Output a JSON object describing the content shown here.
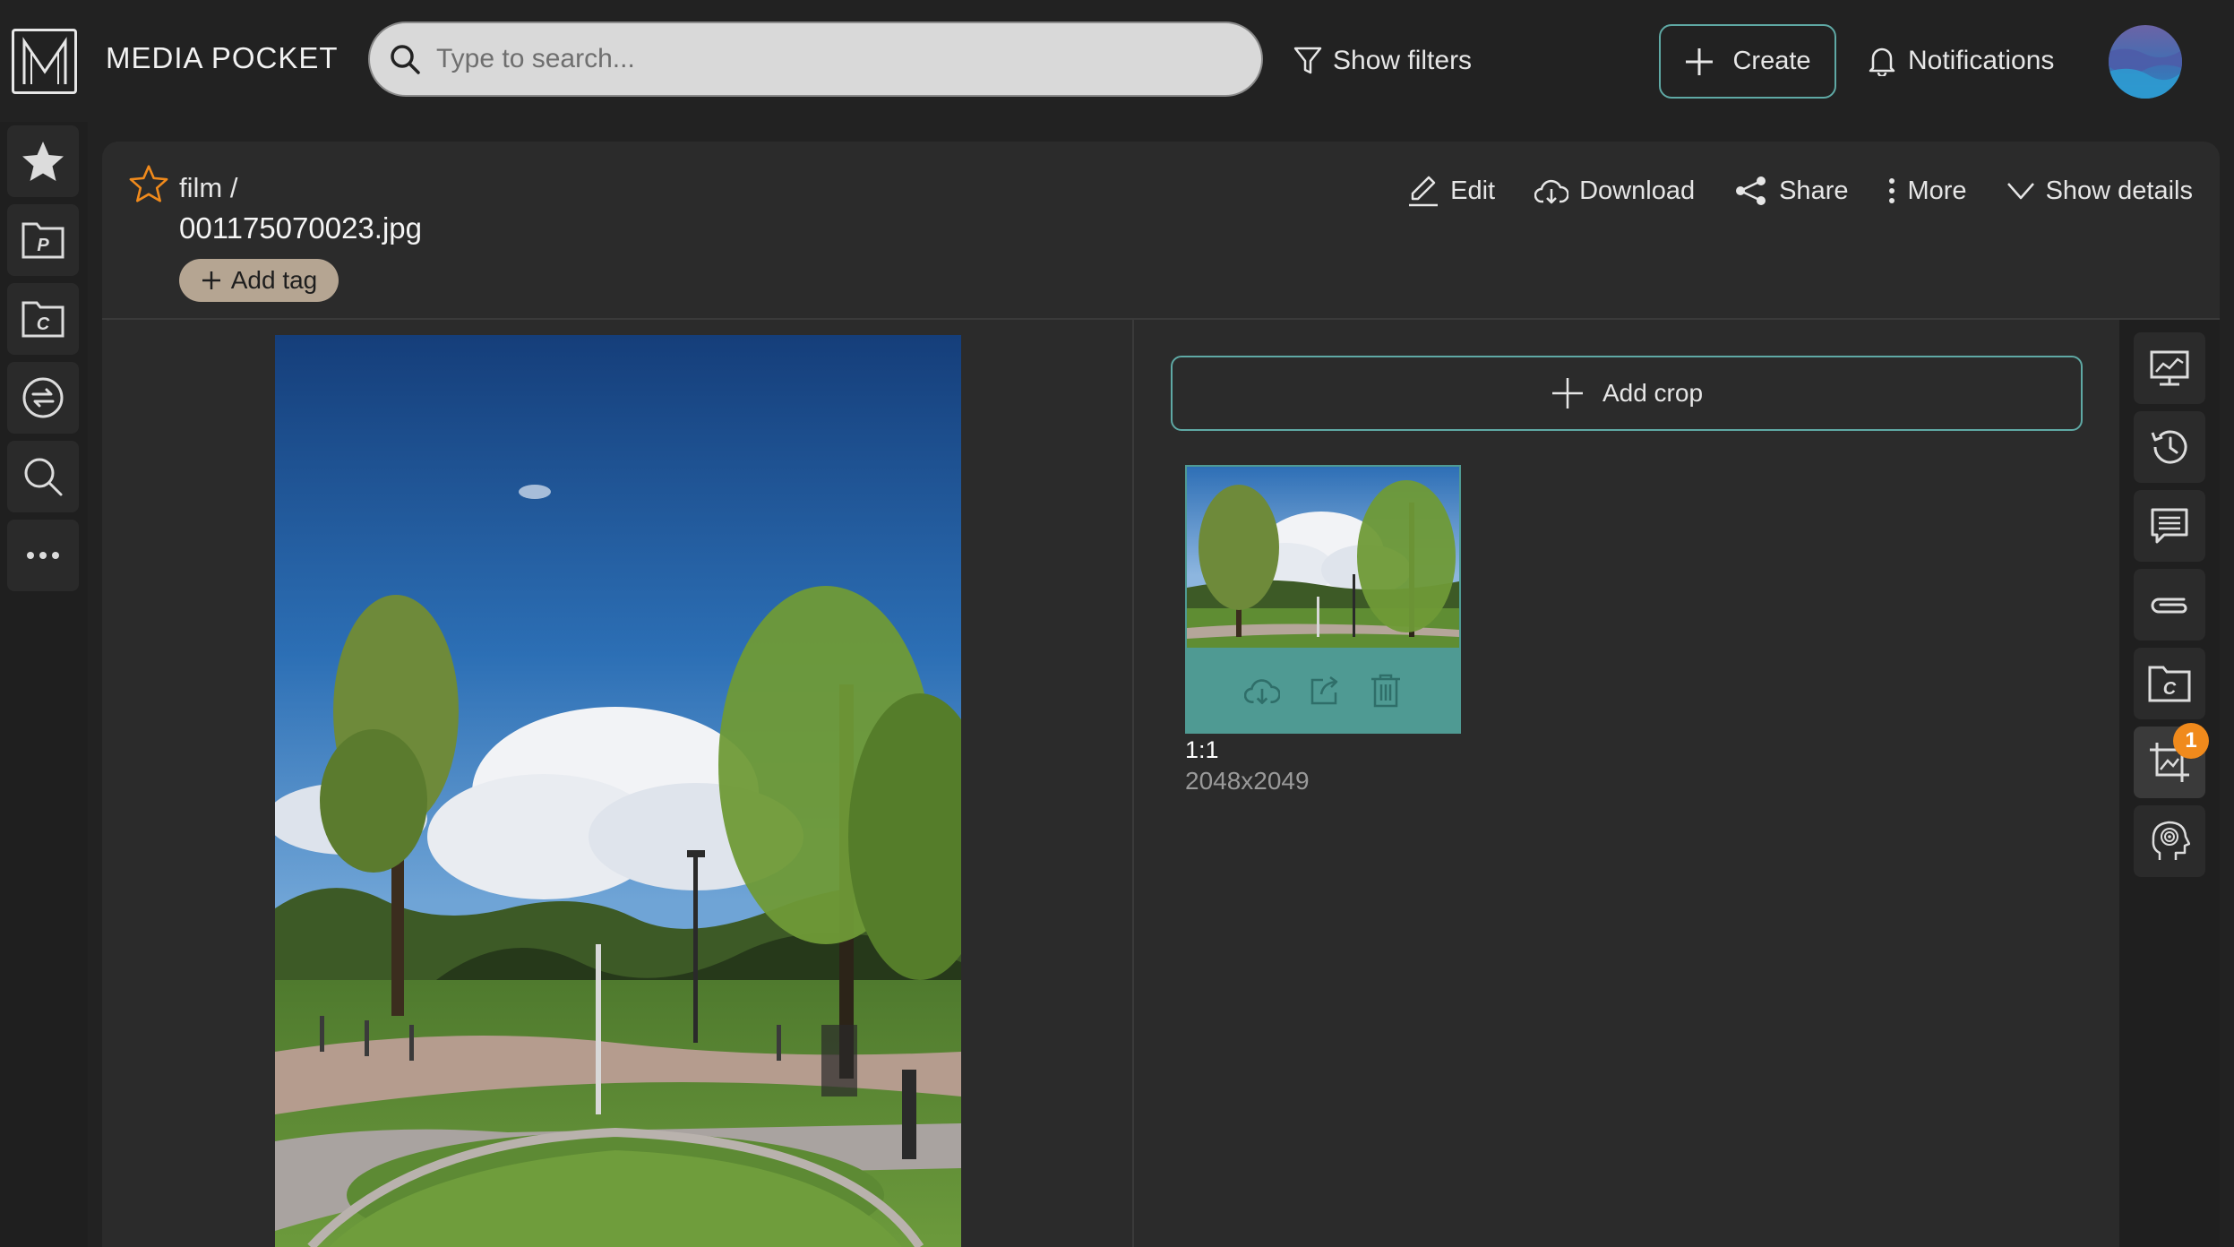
{
  "app": {
    "name": "MEDIA POCKET",
    "logo_icon": "m-logo-icon"
  },
  "search": {
    "placeholder": "Type to search...",
    "value": ""
  },
  "topbar": {
    "show_filters": "Show filters",
    "create": "Create",
    "notifications": "Notifications"
  },
  "sidebar": {
    "items": [
      {
        "icon": "star-icon",
        "label": "Favorites"
      },
      {
        "icon": "folder-p-icon",
        "label": "Projects"
      },
      {
        "icon": "folder-c-icon",
        "label": "Collections"
      },
      {
        "icon": "sync-icon",
        "label": "Sync"
      },
      {
        "icon": "search-icon",
        "label": "Search"
      },
      {
        "icon": "more-icon",
        "label": "More"
      }
    ]
  },
  "asset": {
    "breadcrumb": "film /",
    "filename": "001175070023.jpg",
    "add_tag": "Add tag",
    "favorited": false
  },
  "actions": {
    "edit": "Edit",
    "download": "Download",
    "share": "Share",
    "more": "More",
    "show_details": "Show details"
  },
  "crops": {
    "add_crop": "Add crop",
    "items": [
      {
        "ratio": "1:1",
        "size": "2048x2049"
      }
    ]
  },
  "rail": {
    "items": [
      {
        "icon": "presentation-icon"
      },
      {
        "icon": "history-icon"
      },
      {
        "icon": "comments-icon"
      },
      {
        "icon": "attachment-icon"
      },
      {
        "icon": "collection-icon"
      },
      {
        "icon": "crop-icon",
        "badge": "1",
        "active": true
      },
      {
        "icon": "ai-head-icon"
      }
    ]
  },
  "colors": {
    "accent": "#5fa9a5",
    "crop_card": "#4f9a93",
    "tag": "#b5a592",
    "badge": "#f08a1c",
    "star": "#f08a1c"
  }
}
